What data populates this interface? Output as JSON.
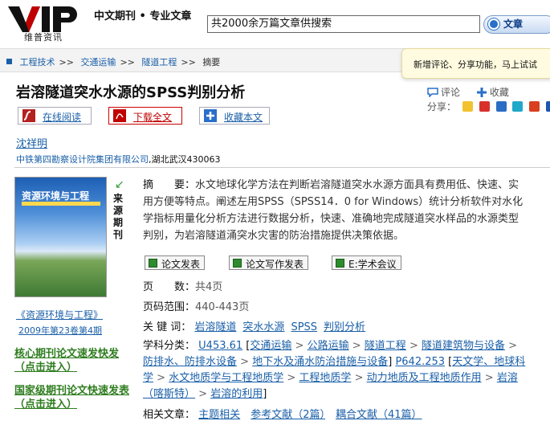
{
  "header": {
    "logo_sub": "维普资讯",
    "tagline": "中文期刊 • 专业文章",
    "search_value": "共2000余万篇文章供搜索",
    "search_button": "文章"
  },
  "breadcrumb": [
    "工程技术",
    "交通运输",
    "隧道工程",
    "摘要"
  ],
  "notice": "新增评论、分享功能，马上试试",
  "article": {
    "title": "岩溶隧道突水水源的SPSS判别分析",
    "author": "沈祥明",
    "org": "中铁第四勘察设计院集团有限公司",
    "org_suffix": ",湖北武汉430063"
  },
  "tools": {
    "comment": "评论",
    "collect": "收藏",
    "share_label": "分享："
  },
  "actions": {
    "read_online": "在线阅读",
    "download": "下载全文",
    "collect": "收藏本文"
  },
  "source": {
    "label": "来源期刊",
    "cover_title": "资源环境与工程",
    "journal": "《资源环境与工程》",
    "issue": "2009年第23卷第4期"
  },
  "promos": [
    "核心期刊论文速发快发（点击进入）",
    "国家级期刊论文快速发表（点击进入）"
  ],
  "abstract": {
    "label": "摘　　要：",
    "text": "水文地球化学方法在判断岩溶隧道突水水源方面具有费用低、快速、实用方便等特点。阐述左用SPSS（SPSS14．0 for Windows）统计分析软件对水化学指标用量化分析方法进行数据分析，快速、准确地完成隧道突水样品的水源类型判别，为岩溶隧道涌突水灾害的防治措施提供决策依据。"
  },
  "buttons": [
    "论文发表",
    "论文写作发表",
    "E:学术会议"
  ],
  "meta": {
    "pages_label": "页　　数：",
    "pages": "共4页",
    "range_label": "页码范围：",
    "range": "440-443页",
    "kw_label": "关 键 词：",
    "keywords": [
      "岩溶隧道",
      "突水水源",
      "SPSS",
      "判别分析"
    ],
    "cls_label": "学科分类：",
    "cls_code1": "U453.61",
    "cls_items1": [
      "交通运输",
      "公路运输",
      "隧道工程",
      "隧道建筑物与设备",
      "防排水、防排水设备",
      "地下水及涌水防治措施与设备"
    ],
    "cls_code2": "P642.253",
    "cls_items2": [
      "天文学、地球科学",
      "水文地质学与工程地质学",
      "工程地质学",
      "动力地质及工程地质作用",
      "岩溶（喀斯特）",
      "岩溶的利用"
    ],
    "related_label": "相关文章：",
    "related": [
      "主题相关",
      "参考文献（2篇）",
      "耦合文献（41篇）"
    ]
  },
  "colors": {
    "link": "#1a5fa8",
    "green": "#2e7d1f",
    "accent_red": "#c00000"
  }
}
